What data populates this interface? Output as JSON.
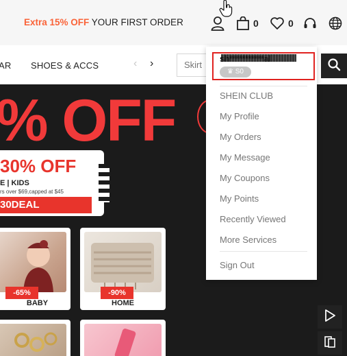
{
  "promo": {
    "highlight": "Extra 15% OFF",
    "rest": " YOUR FIRST ORDER"
  },
  "header": {
    "cart_count": "0",
    "wishlist_count": "0"
  },
  "nav": {
    "items": [
      "AR",
      "SHOES & ACCS"
    ],
    "prev_arrow": "‹",
    "next_arrow": "›",
    "search_placeholder": "Skirt"
  },
  "hero": {
    "headline": "% OFF",
    "coupon": {
      "percent": "30% OFF",
      "categories": "E | KIDS",
      "condition": "rs over $69,capped at $45",
      "code": "30DEAL"
    },
    "tiles": [
      {
        "label": "BABY",
        "discount": "-65%"
      },
      {
        "label": "HOME",
        "discount": "-90%"
      }
    ]
  },
  "account_menu": {
    "username": "sh***********al",
    "points_badge": "♛ S0",
    "items": [
      "SHEIN CLUB",
      "My Profile",
      "My Orders",
      "My Message",
      "My Coupons",
      "My Points",
      "Recently Viewed",
      "More Services"
    ],
    "sign_out": "Sign Out"
  },
  "colors": {
    "promo_accent": "#fa6338",
    "hero_red": "#f13a3a",
    "highlight_box": "#e0221f"
  },
  "icons": [
    "user-icon",
    "bag-icon",
    "heart-icon",
    "headset-icon",
    "globe-icon",
    "search-icon",
    "play-icon",
    "compare-icon",
    "hand-cursor-icon"
  ]
}
